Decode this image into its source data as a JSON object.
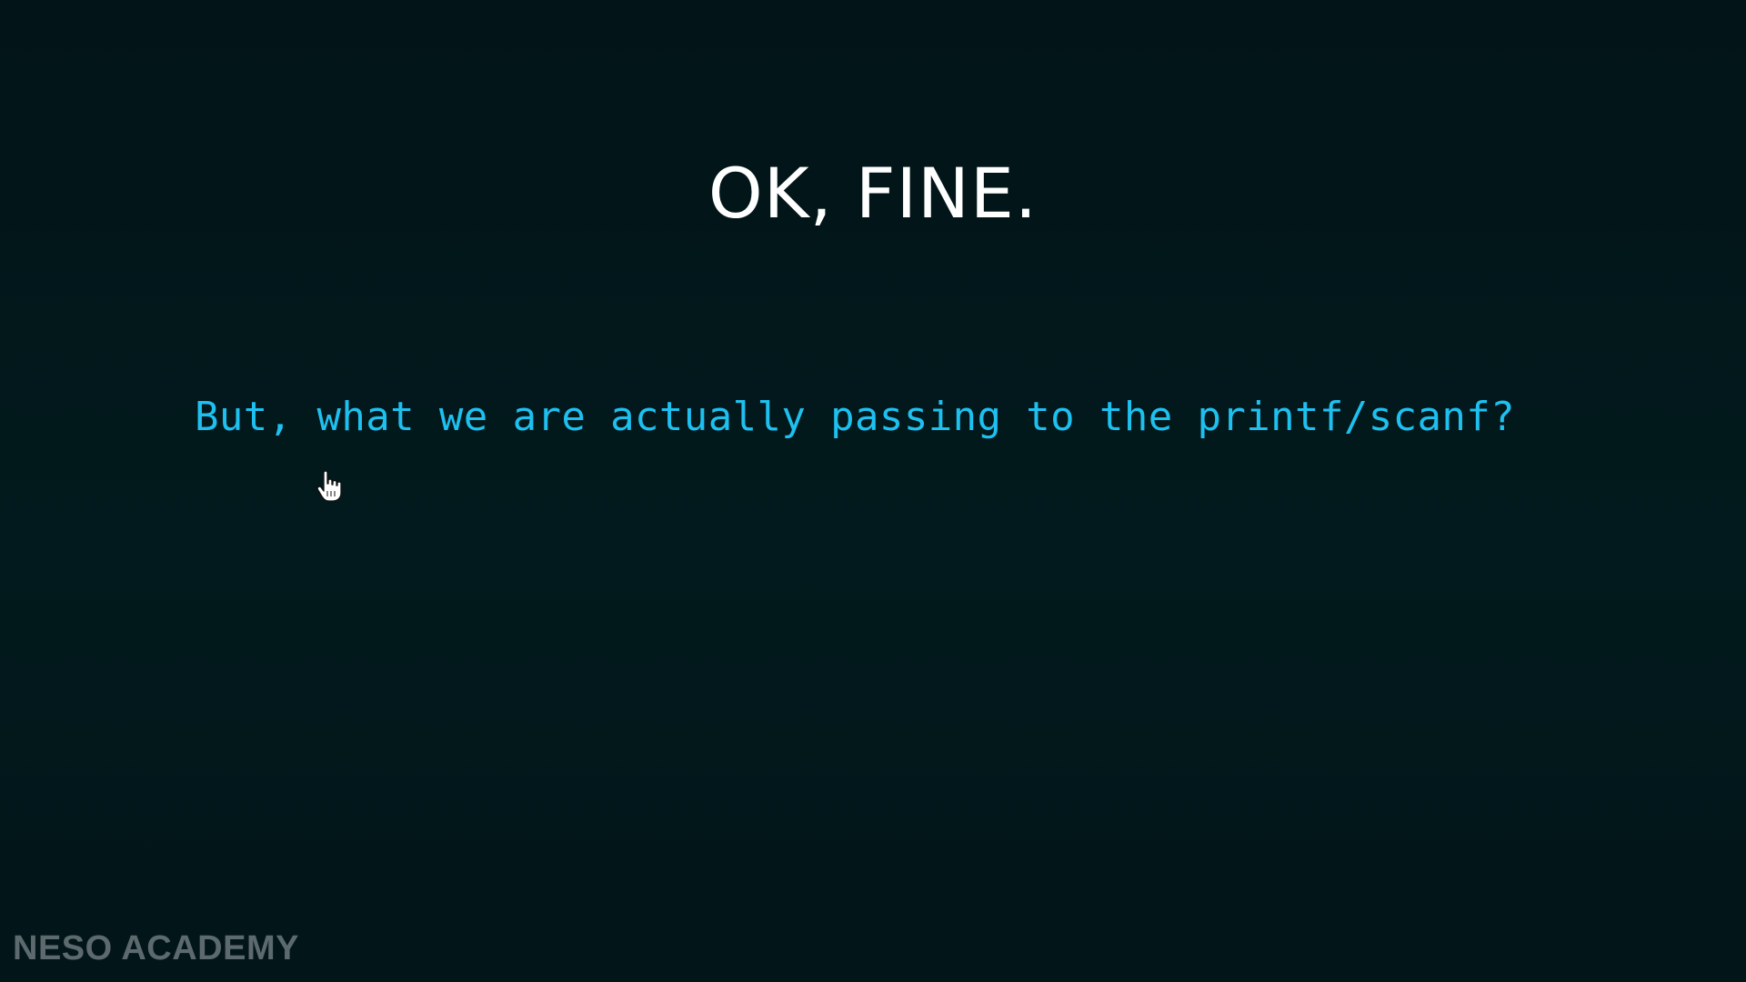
{
  "slide": {
    "title": "OK, FINE.",
    "question": "But, what we are actually passing to the printf/scanf?",
    "cursor_icon": "hand-pointer-icon",
    "watermark": "NESO ACADEMY"
  },
  "colors": {
    "background": "#021a1d",
    "title": "#ffffff",
    "question": "#1ec0f0",
    "watermark": "#5d6a6d"
  }
}
